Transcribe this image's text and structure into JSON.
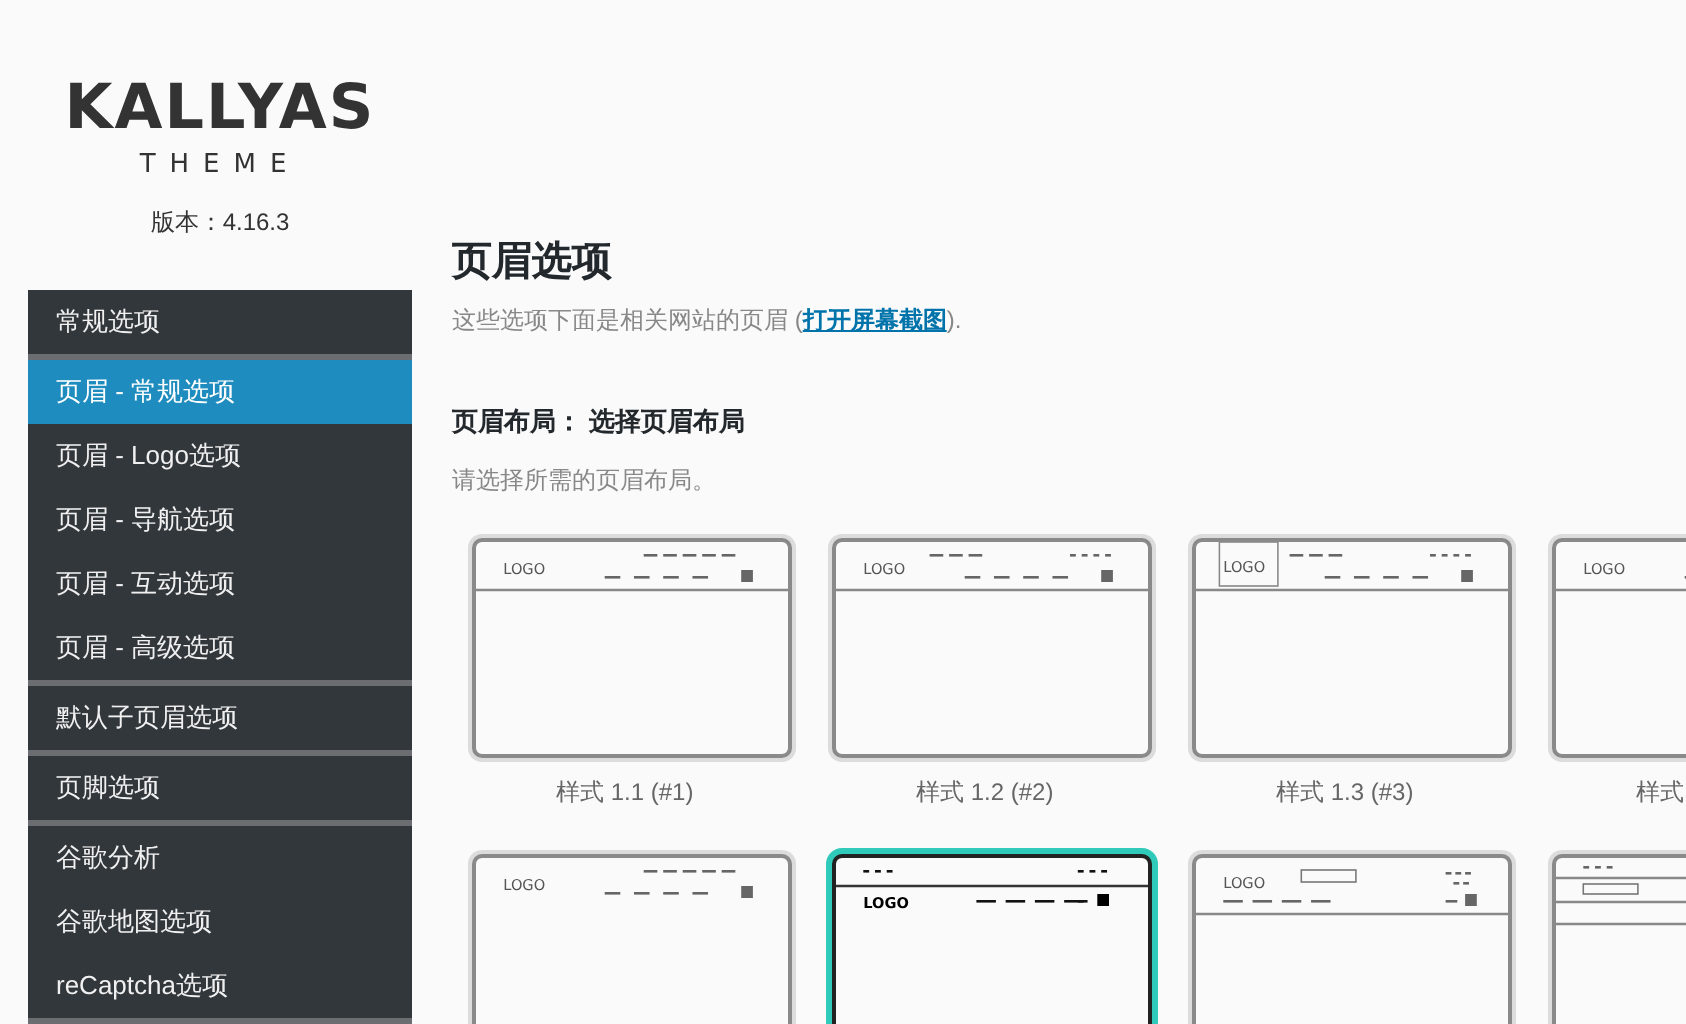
{
  "brand": {
    "name": "KALLYAS",
    "sub": "THEME",
    "version": "版本：4.16.3"
  },
  "menu": {
    "groups": [
      {
        "items": [
          {
            "label": "常规选项",
            "selected": false
          }
        ]
      },
      {
        "items": [
          {
            "label": "页眉 - 常规选项",
            "selected": true
          },
          {
            "label": "页眉 - Logo选项",
            "selected": false
          },
          {
            "label": "页眉 - 导航选项",
            "selected": false
          },
          {
            "label": "页眉 - 互动选项",
            "selected": false
          },
          {
            "label": "页眉 - 高级选项",
            "selected": false
          }
        ]
      },
      {
        "items": [
          {
            "label": "默认子页眉选项",
            "selected": false
          }
        ]
      },
      {
        "items": [
          {
            "label": "页脚选项",
            "selected": false
          }
        ]
      },
      {
        "items": [
          {
            "label": "谷歌分析",
            "selected": false
          },
          {
            "label": "谷歌地图选项",
            "selected": false
          },
          {
            "label": "reCaptcha选项",
            "selected": false
          }
        ]
      }
    ]
  },
  "page": {
    "title": "页眉选项",
    "description_before": "这些选项下面是相关网站的页眉 (",
    "link": "打开屏幕截图",
    "description_after": ")."
  },
  "field": {
    "label": "页眉布局： 选择页眉布局",
    "hint": "请选择所需的页眉布局。"
  },
  "layouts": [
    {
      "kind": "classic",
      "logo": "LOGO",
      "label": "样式 1.1 (#1)",
      "selected": false
    },
    {
      "kind": "split",
      "logo": "LOGO",
      "label": "样式 1.2 (#2)",
      "selected": false
    },
    {
      "kind": "boxed",
      "logo": "LOGO",
      "label": "样式 1.3 (#3)",
      "selected": false
    },
    {
      "kind": "classic",
      "logo": "LOGO",
      "label": "样式",
      "selected": false
    },
    {
      "kind": "open",
      "logo": "LOGO",
      "selected": false
    },
    {
      "kind": "stacked",
      "logo": "LOGO",
      "selected": true
    },
    {
      "kind": "search",
      "logo": "LOGO",
      "selected": false
    },
    {
      "kind": "topbar",
      "selected": false
    }
  ]
}
